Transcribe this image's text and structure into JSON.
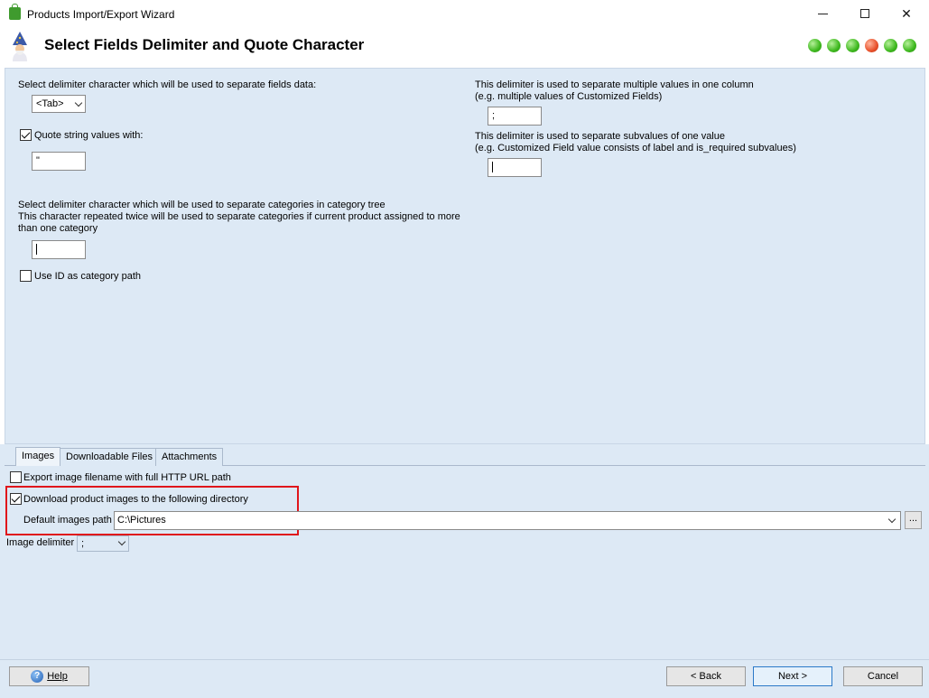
{
  "window": {
    "title": "Products Import/Export Wizard",
    "minimize_icon": "minimize-icon",
    "maximize_icon": "maximize-icon",
    "close_icon": "close-icon"
  },
  "header": {
    "title": "Select Fields Delimiter and Quote Character",
    "progress_dots": [
      "green",
      "green",
      "green",
      "red",
      "green",
      "green"
    ],
    "colors": {
      "green": "#3db81d",
      "red": "#e8502a"
    }
  },
  "fields": {
    "delimiter_label": "Select delimiter character which will be used to separate fields data:",
    "delimiter_value": "<Tab>",
    "quote_label": "Quote string values with:",
    "quote_checked": true,
    "quote_value": "\"",
    "category_label_1": "Select delimiter character which will be used to separate categories in category tree",
    "category_label_2": "This character repeated twice will be used to separate categories if current product assigned to more",
    "category_label_3": "than one category",
    "category_value": "",
    "use_id_label": "Use ID as category path",
    "use_id_checked": false,
    "multi_label_1": "This delimiter is used to separate multiple values in one column",
    "multi_label_2": "(e.g. multiple values of Customized Fields)",
    "multi_value": ";",
    "sub_label_1": "This delimiter is used to separate subvalues of one value",
    "sub_label_2": "(e.g. Customized Field value consists of label and is_required subvalues)",
    "sub_value": ""
  },
  "tabs": [
    {
      "label": "Images",
      "active": true
    },
    {
      "label": "Downloadable Files",
      "active": false
    },
    {
      "label": "Attachments",
      "active": false
    }
  ],
  "images": {
    "export_full_url_label": "Export image filename with full HTTP URL path",
    "export_full_url_checked": false,
    "download_label": "Download product images to the following directory",
    "download_checked": true,
    "default_path_label": "Default images path",
    "default_path_value": "C:\\Pictures",
    "browse_label": "...",
    "image_delimiter_label": "Image delimiter",
    "image_delimiter_value": ";"
  },
  "buttons": {
    "help": "Help",
    "back": "< Back",
    "next": "Next >",
    "cancel": "Cancel"
  }
}
